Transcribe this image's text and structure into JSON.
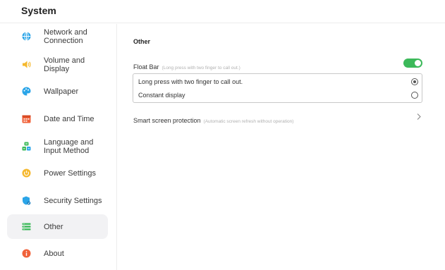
{
  "header": {
    "title": "System"
  },
  "sidebar": {
    "items": [
      {
        "label": "Network and Connection",
        "icon": "globe-icon",
        "color": "#2ba5e8"
      },
      {
        "label": "Volume and Display",
        "icon": "speaker-icon",
        "color": "#f5b82e"
      },
      {
        "label": "Wallpaper",
        "icon": "palette-icon",
        "color": "#2ba5e8"
      },
      {
        "label": "Date and Time",
        "icon": "calendar-icon",
        "color": "#f0623a"
      },
      {
        "label": "Language and Input Method",
        "icon": "input-method-icon",
        "color": "#3cb95a"
      },
      {
        "label": "Power Settings",
        "icon": "power-icon",
        "color": "#f5b82e"
      },
      {
        "label": "Security Settings",
        "icon": "shield-icon",
        "color": "#2ba5e8"
      },
      {
        "label": "Other",
        "icon": "list-icon",
        "color": "#3cb95a",
        "active": true
      },
      {
        "label": "About",
        "icon": "info-icon",
        "color": "#f0623a"
      }
    ]
  },
  "main": {
    "section_title": "Other",
    "float_bar": {
      "label": "Float Bar",
      "hint": "(Long press with two finger to call out.)",
      "enabled": true
    },
    "float_options": [
      {
        "label": "Long press with two finger to call out.",
        "selected": true
      },
      {
        "label": "Constant display",
        "selected": false
      }
    ],
    "smart_screen": {
      "label": "Smart screen protection",
      "hint": "(Automatic screen refresh without operation)"
    }
  },
  "colors": {
    "accent": "#3cb95a",
    "active_bg": "#f2f2f4"
  }
}
